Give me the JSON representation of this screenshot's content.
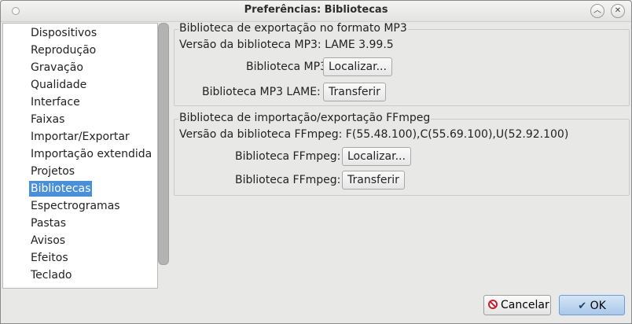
{
  "window": {
    "title": "Preferências: Bibliotecas"
  },
  "sidebar": {
    "items": [
      {
        "label": "Dispositivos"
      },
      {
        "label": "Reprodução"
      },
      {
        "label": "Gravação"
      },
      {
        "label": "Qualidade"
      },
      {
        "label": "Interface"
      },
      {
        "label": "Faixas"
      },
      {
        "label": "Importar/Exportar"
      },
      {
        "label": "Importação extendida"
      },
      {
        "label": "Projetos"
      },
      {
        "label": "Bibliotecas",
        "selected": true
      },
      {
        "label": "Espectrogramas"
      },
      {
        "label": "Pastas"
      },
      {
        "label": "Avisos"
      },
      {
        "label": "Efeitos"
      },
      {
        "label": "Teclado"
      }
    ]
  },
  "mp3_group": {
    "title": "Biblioteca de exportação no formato MP3",
    "version_label": "Versão da biblioteca MP3: LAME 3.99.5",
    "library_label": "Biblioteca MP3:",
    "locate_button": "Localizar...",
    "lame_label": "Biblioteca MP3 LAME:",
    "download_button": "Transferir"
  },
  "ffmpeg_group": {
    "title": "Biblioteca de importação/exportação FFmpeg",
    "version_label": "Versão da biblioteca FFmpeg: F(55.48.100),C(55.69.100),U(52.92.100)",
    "library_label": "Biblioteca FFmpeg:",
    "locate_button": "Localizar...",
    "library_label_2": "Biblioteca FFmpeg:",
    "download_button": "Transferir"
  },
  "footer": {
    "cancel_label": "Cancelar",
    "ok_label": "OK"
  },
  "colors": {
    "selection": "#4a90d9",
    "ok_button": "#a9c8ea",
    "cancel_icon": "#c8202a"
  }
}
